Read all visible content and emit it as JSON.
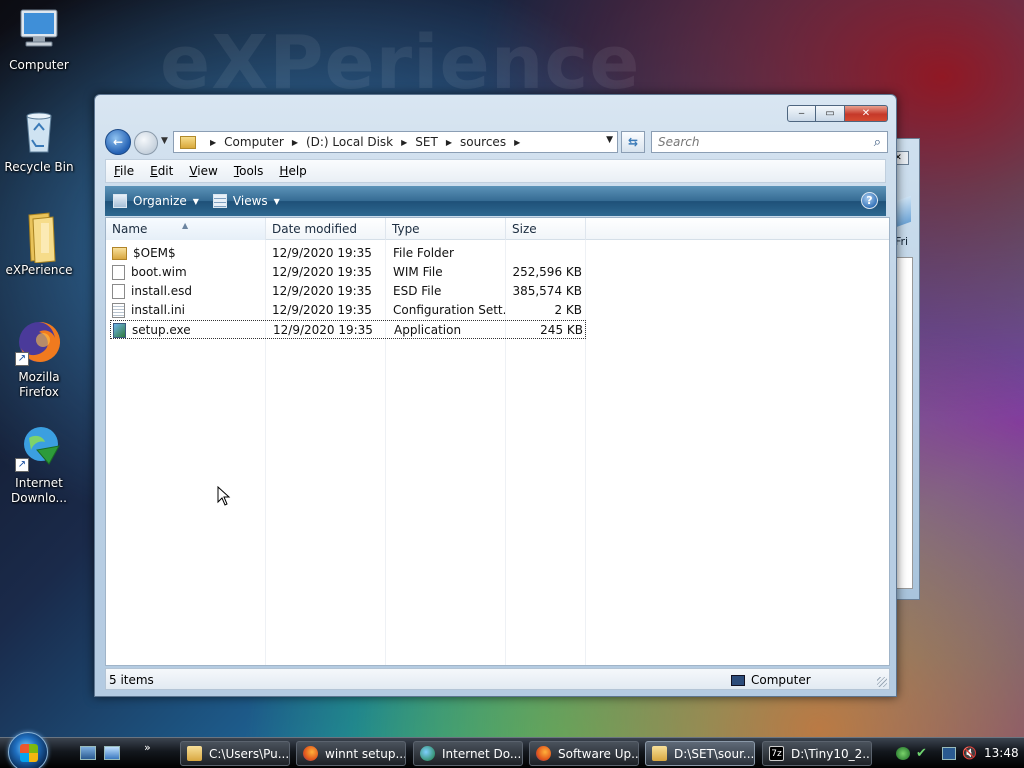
{
  "desktop": {
    "wallpaper_text": "eXPerience",
    "icons": [
      {
        "label": "Computer",
        "icon": "computer-icon"
      },
      {
        "label": "Recycle Bin",
        "icon": "recycle-bin-icon"
      },
      {
        "label": "eXPerience",
        "icon": "folder-icon"
      },
      {
        "label_line1": "Mozilla",
        "label_line2": "Firefox",
        "icon": "firefox-icon"
      },
      {
        "label_line1": "Internet",
        "label_line2": "Downlo...",
        "icon": "internet-download-manager-icon"
      }
    ],
    "background_window_text": "Fri"
  },
  "explorer": {
    "window_controls": {
      "minimize": "‒",
      "maximize": "▭",
      "close": "✕"
    },
    "breadcrumb": [
      "Computer",
      "(D:) Local Disk",
      "SET",
      "sources"
    ],
    "search_placeholder": "Search",
    "menu": [
      {
        "label": "File",
        "accel": "F"
      },
      {
        "label": "Edit",
        "accel": "E"
      },
      {
        "label": "View",
        "accel": "V"
      },
      {
        "label": "Tools",
        "accel": "T"
      },
      {
        "label": "Help",
        "accel": "H"
      }
    ],
    "commands": {
      "organize": "Organize",
      "views": "Views",
      "help": "?"
    },
    "columns": [
      "Name",
      "Date modified",
      "Type",
      "Size"
    ],
    "files": [
      {
        "name": "$OEM$",
        "date": "12/9/2020 19:35",
        "type": "File Folder",
        "size": "",
        "icon": "folder-icon"
      },
      {
        "name": "boot.wim",
        "date": "12/9/2020 19:35",
        "type": "WIM File",
        "size": "252,596 KB",
        "icon": "file-icon"
      },
      {
        "name": "install.esd",
        "date": "12/9/2020 19:35",
        "type": "ESD File",
        "size": "385,574 KB",
        "icon": "file-icon"
      },
      {
        "name": "install.ini",
        "date": "12/9/2020 19:35",
        "type": "Configuration Sett...",
        "size": "2 KB",
        "icon": "config-file-icon"
      },
      {
        "name": "setup.exe",
        "date": "12/9/2020 19:35",
        "type": "Application",
        "size": "245 KB",
        "icon": "setup-app-icon",
        "selected": true
      }
    ],
    "status": {
      "item_count": "5 items",
      "location": "Computer"
    }
  },
  "taskbar": {
    "tasks": [
      {
        "label": "C:\\Users\\Pu...",
        "icon": "folder-icon"
      },
      {
        "label": "winnt setup...",
        "icon": "firefox-icon"
      },
      {
        "label": "Internet Do...",
        "icon": "internet-download-manager-icon"
      },
      {
        "label": "Software Up...",
        "icon": "firefox-icon"
      },
      {
        "label": "D:\\SET\\sour...",
        "icon": "folder-icon",
        "active": true
      },
      {
        "label": "D:\\Tiny10_2...",
        "icon": "7zip-icon"
      }
    ],
    "quick_launch_more": "»",
    "seven_zip_glyph": "7z",
    "clock": "13:48"
  }
}
